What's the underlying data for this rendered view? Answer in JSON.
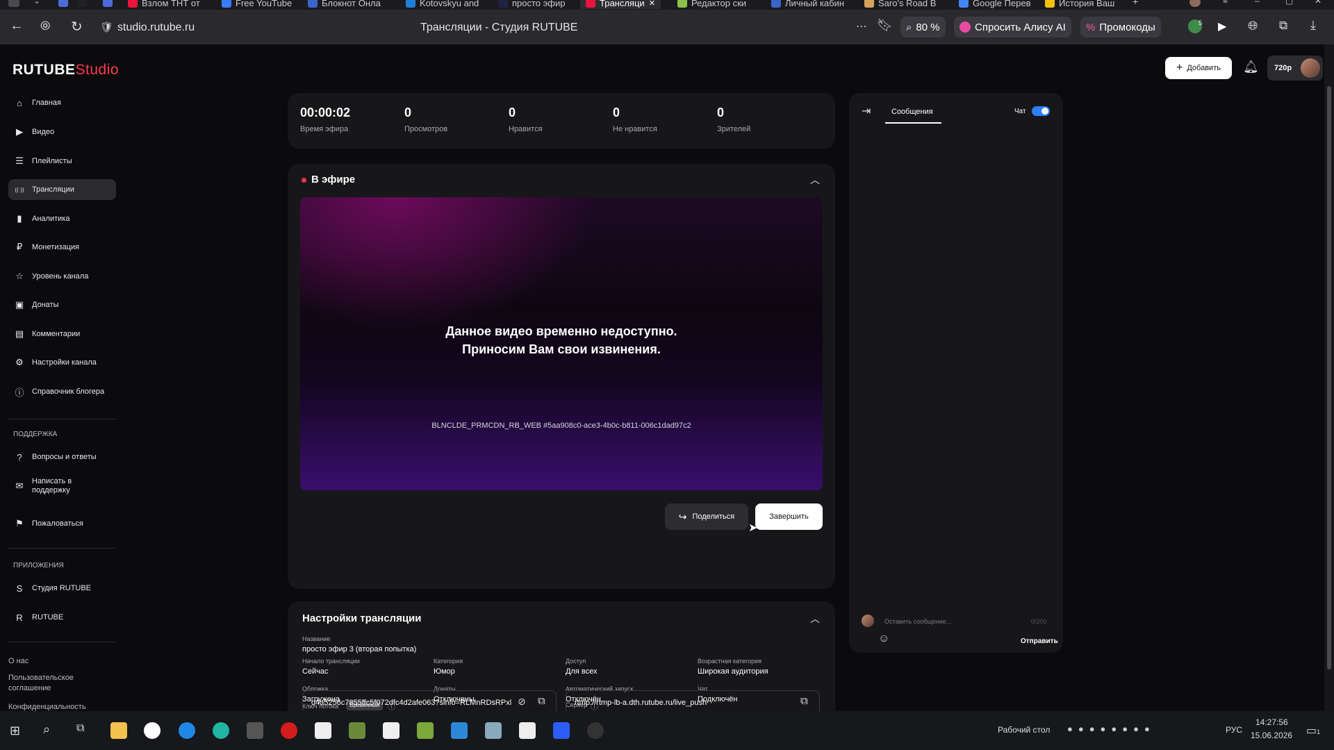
{
  "browser": {
    "tabs": [
      {
        "label": "Взлом ТНТ от",
        "color": "#e8143c"
      },
      {
        "label": "Free YouTube",
        "color": "#3b7cff"
      },
      {
        "label": "Блокнот Онла",
        "color": "#3b64c8"
      },
      {
        "label": "Kotovskyu and",
        "color": "#1f7fd8"
      },
      {
        "label": "просто эфир",
        "color": "#222244"
      },
      {
        "label": "Трансляци",
        "color": "#e8143c",
        "active": true
      },
      {
        "label": "Редактор ски",
        "color": "#8bc34a"
      },
      {
        "label": "Личный кабин",
        "color": "#3b64c8"
      },
      {
        "label": "Saro's Road B",
        "color": "#d6a35a"
      },
      {
        "label": "Google Перев",
        "color": "#4285f4"
      },
      {
        "label": "История Ваш",
        "color": "#f4c20d"
      }
    ],
    "url": "studio.rutube.ru",
    "page_title": "Трансляции - Студия RUTUBE",
    "zoom": "80 %",
    "alice_label": "Спросить Алису AI",
    "promo_label": "Промокоды",
    "shield_badge": "5"
  },
  "header": {
    "logo_main": "RUTUBE",
    "logo_studio": "Studio",
    "add_label": "Добавить",
    "quality": "720p"
  },
  "sidebar": {
    "items": [
      {
        "label": "Главная",
        "icon": "home-icon"
      },
      {
        "label": "Видео",
        "icon": "video-icon"
      },
      {
        "label": "Плейлисты",
        "icon": "playlist-icon"
      },
      {
        "label": "Трансляции",
        "icon": "broadcast-icon",
        "active": true
      },
      {
        "label": "Аналитика",
        "icon": "analytics-icon"
      },
      {
        "label": "Монетизация",
        "icon": "monetization-icon"
      },
      {
        "label": "Уровень канала",
        "icon": "star-icon"
      },
      {
        "label": "Донаты",
        "icon": "gift-icon"
      },
      {
        "label": "Комментарии",
        "icon": "comment-icon"
      },
      {
        "label": "Настройки канала",
        "icon": "gear-icon"
      },
      {
        "label": "Справочник блогера",
        "icon": "info-icon"
      }
    ],
    "support_heading": "ПОДДЕРЖКА",
    "support_items": [
      {
        "label": "Вопросы и ответы",
        "icon": "question-icon"
      },
      {
        "label": "Написать в поддержку",
        "icon": "mail-icon"
      },
      {
        "label": "Пожаловаться",
        "icon": "flag-icon"
      }
    ],
    "apps_heading": "ПРИЛОЖЕНИЯ",
    "app_items": [
      {
        "label": "Студия RUTUBE",
        "icon": "studio-app-icon"
      },
      {
        "label": "RUTUBE",
        "icon": "rutube-app-icon"
      }
    ],
    "footer": {
      "about": "О нас",
      "agreement": "Пользовательское соглашение",
      "privacy": "Конфиденциальность"
    }
  },
  "stats": [
    {
      "value": "00:00:02",
      "label": "Время эфира"
    },
    {
      "value": "0",
      "label": "Просмотров"
    },
    {
      "value": "0",
      "label": "Нравится"
    },
    {
      "value": "0",
      "label": "Не нравится"
    },
    {
      "value": "0",
      "label": "Зрителей"
    }
  ],
  "live": {
    "title": "В эфире",
    "message_line1": "Данное видео временно недоступно.",
    "message_line2": "Приносим Вам свои извинения.",
    "error_code": "BLNCLDE_PRMCDN_RB_WEB #5aa908c0-ace3-4b0c-b811-006c1dad97c2",
    "share_label": "Поделиться",
    "finish_label": "Завершить"
  },
  "settings": {
    "title": "Настройки трансляции",
    "name_label": "Название",
    "name_value": "просто эфир 3 (вторая попытка)",
    "rows": [
      [
        {
          "label": "Начало трансляции",
          "value": "Сейчас"
        },
        {
          "label": "Категория",
          "value": "Юмор"
        },
        {
          "label": "Доступ",
          "value": "Для всех"
        },
        {
          "label": "Возрастная категория",
          "value": "Широкая аудитория"
        }
      ],
      [
        {
          "label": "Обложка",
          "value": "Загружена"
        },
        {
          "label": "Донаты",
          "value": "Отключены"
        },
        {
          "label": "Автоматический запуск",
          "value": "Отключён"
        },
        {
          "label": "Чат",
          "value": "Подключён"
        }
      ]
    ],
    "key_label": "Ключ потока",
    "key_badge": "Временный",
    "key_value": "d4a5256c7855ffc5f072dfc4d2afe063?sinfo=RLMnRDsRPxl",
    "server_label": "Сервер",
    "server_value": "rtmp://rtmp-lb-a.dth.rutube.ru/live_push"
  },
  "chat": {
    "tab_label": "Сообщения",
    "toggle_label": "Чат",
    "toggle_on": true,
    "input_placeholder": "Оставить сообщение...",
    "counter": "0/200",
    "send_label": "Отправить"
  },
  "taskbar": {
    "desktop_label": "Рабочий стол",
    "lang": "РУС",
    "time": "14:27:56",
    "date": "15.06.2026",
    "notifications": "1"
  }
}
